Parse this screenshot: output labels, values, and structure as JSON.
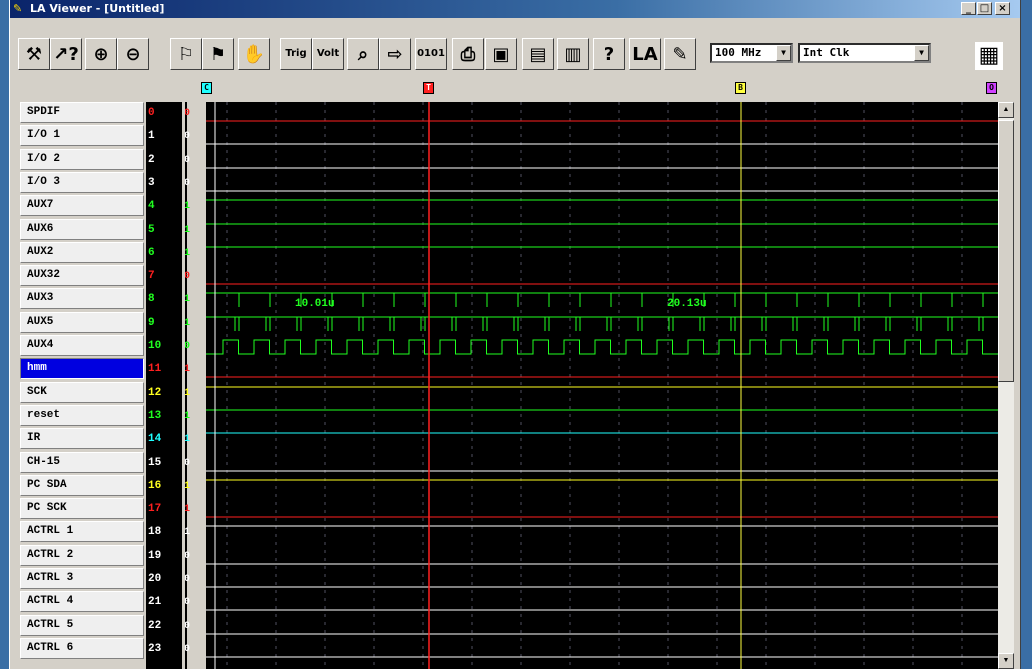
{
  "title": "LA Viewer - [Untitled]",
  "window_buttons": {
    "minimize": "_",
    "maximize": "□",
    "close": "×"
  },
  "toolbar": {
    "buttons": [
      {
        "name": "tools-icon",
        "glyph": "⚒"
      },
      {
        "name": "help-pointer-icon",
        "glyph": "↗?"
      },
      {
        "name": "zoom-in-icon",
        "glyph": "⊕"
      },
      {
        "name": "zoom-out-icon",
        "glyph": "⊖"
      },
      {
        "name": "run-icon",
        "glyph": "⚐"
      },
      {
        "name": "run-stop-icon",
        "glyph": "⚑"
      },
      {
        "name": "hand-pan-icon",
        "glyph": "✋"
      },
      {
        "name": "trigger-icon",
        "glyph": "Trig"
      },
      {
        "name": "voltage-icon",
        "glyph": "Volt"
      },
      {
        "name": "search-waveform-icon",
        "glyph": "⌕"
      },
      {
        "name": "search-next-icon",
        "glyph": "⇨"
      },
      {
        "name": "pattern-0101-icon",
        "glyph": "0101"
      },
      {
        "name": "printer-icon",
        "glyph": "⎙"
      },
      {
        "name": "board-icon",
        "glyph": "▣"
      },
      {
        "name": "monitor-icon",
        "glyph": "▤"
      },
      {
        "name": "print-setup-icon",
        "glyph": "▥"
      },
      {
        "name": "help-book-icon",
        "glyph": "?"
      },
      {
        "name": "la-logo-icon",
        "glyph": "LA"
      },
      {
        "name": "notepad-icon",
        "glyph": "✎"
      }
    ],
    "sample_rate": "100 MHz",
    "clock_source": "Int Clk"
  },
  "markers": {
    "c": "C",
    "t": "T",
    "b": "B",
    "o": "O"
  },
  "channels": [
    {
      "name": "SPDIF",
      "num": "0",
      "val": "0",
      "color": "#ff2020"
    },
    {
      "name": "I/O 1",
      "num": "1",
      "val": "0",
      "color": "#ffffff"
    },
    {
      "name": "I/O 2",
      "num": "2",
      "val": "0",
      "color": "#ffffff"
    },
    {
      "name": "I/O 3",
      "num": "3",
      "val": "0",
      "color": "#ffffff"
    },
    {
      "name": "AUX7",
      "num": "4",
      "val": "1",
      "color": "#20ff20"
    },
    {
      "name": "AUX6",
      "num": "5",
      "val": "1",
      "color": "#20ff20"
    },
    {
      "name": "AUX2",
      "num": "6",
      "val": "1",
      "color": "#20ff20"
    },
    {
      "name": "AUX32",
      "num": "7",
      "val": "0",
      "color": "#ff2020"
    },
    {
      "name": "AUX3",
      "num": "8",
      "val": "1",
      "color": "#20ff20"
    },
    {
      "name": "AUX5",
      "num": "9",
      "val": "1",
      "color": "#20ff20"
    },
    {
      "name": "AUX4",
      "num": "10",
      "val": "0",
      "color": "#20ff20"
    },
    {
      "name": "hmm",
      "num": "11",
      "val": "1",
      "color": "#ff2020"
    },
    {
      "name": "SCK",
      "num": "12",
      "val": "1",
      "color": "#ffff20"
    },
    {
      "name": "reset",
      "num": "13",
      "val": "1",
      "color": "#20ff20"
    },
    {
      "name": "IR",
      "num": "14",
      "val": "1",
      "color": "#20ffff"
    },
    {
      "name": "CH-15",
      "num": "15",
      "val": "0",
      "color": "#ffffff"
    },
    {
      "name": "PC SDA",
      "num": "16",
      "val": "1",
      "color": "#ffff20"
    },
    {
      "name": "PC SCK",
      "num": "17",
      "val": "1",
      "color": "#ff2020"
    },
    {
      "name": "ACTRL 1",
      "num": "18",
      "val": "1",
      "color": "#ffffff"
    },
    {
      "name": "ACTRL 2",
      "num": "19",
      "val": "0",
      "color": "#ffffff"
    },
    {
      "name": "ACTRL 3",
      "num": "20",
      "val": "0",
      "color": "#ffffff"
    },
    {
      "name": "ACTRL 4",
      "num": "21",
      "val": "0",
      "color": "#ffffff"
    },
    {
      "name": "ACTRL 5",
      "num": "22",
      "val": "0",
      "color": "#ffffff"
    },
    {
      "name": "ACTRL 6",
      "num": "23",
      "val": "0",
      "color": "#ffffff"
    }
  ],
  "selected_channel": "hmm",
  "measurements": {
    "first": "10.01u",
    "second": "20.13u"
  }
}
